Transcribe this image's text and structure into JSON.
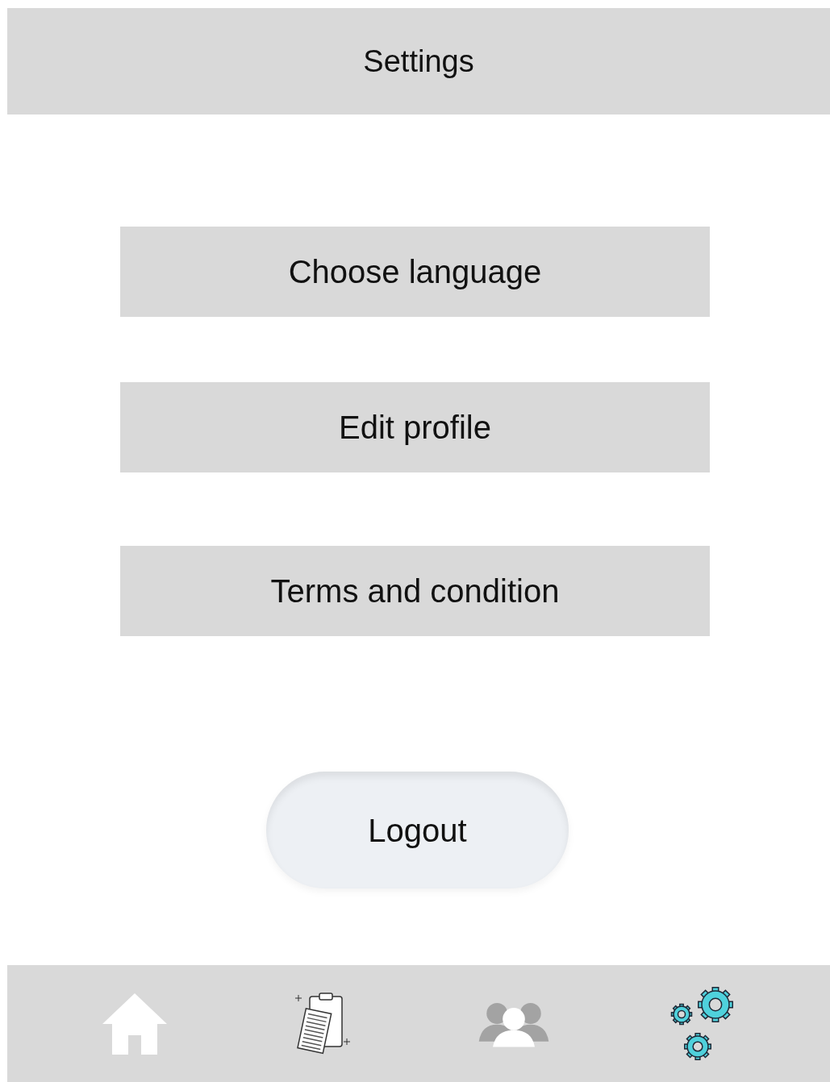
{
  "header": {
    "title": "Settings"
  },
  "options": [
    {
      "label": "Choose language"
    },
    {
      "label": "Edit profile"
    },
    {
      "label": "Terms and condition"
    }
  ],
  "logout": {
    "label": "Logout"
  },
  "nav": [
    {
      "kind": "home",
      "selected": false
    },
    {
      "kind": "clipboard",
      "selected": false
    },
    {
      "kind": "people",
      "selected": false
    },
    {
      "kind": "gears",
      "selected": true
    }
  ]
}
